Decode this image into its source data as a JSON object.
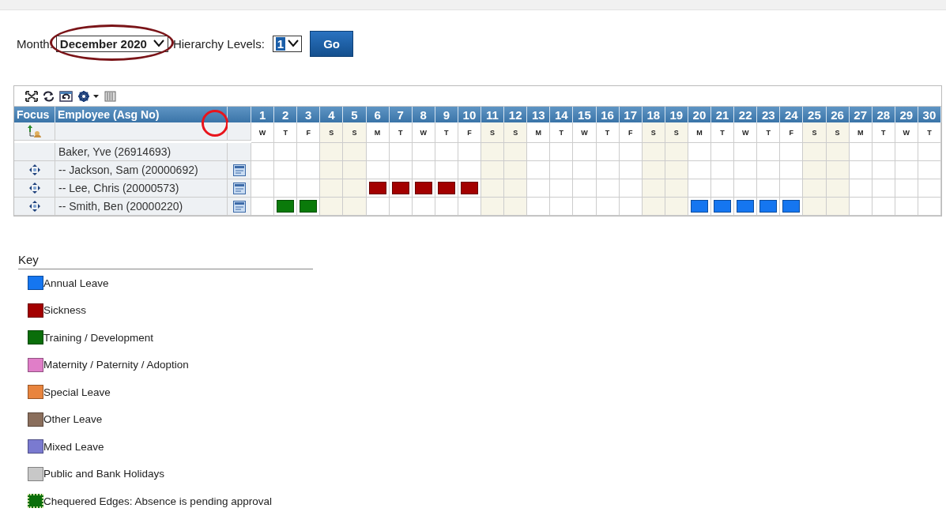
{
  "filters": {
    "month_label": "Month:",
    "month": "December 2020",
    "month_circled": true,
    "levels_label": "Hierarchy Levels:",
    "levels": "1",
    "go": "Go"
  },
  "table": {
    "columns": [
      "Focus",
      "Employee (Asg No)"
    ],
    "column_circled": true,
    "days": [
      {
        "day": "1",
        "weekday": "W",
        "weekend": false
      },
      {
        "day": "2",
        "weekday": "T",
        "weekend": false
      },
      {
        "day": "3",
        "weekday": "F",
        "weekend": false
      },
      {
        "day": "4",
        "weekday": "S",
        "weekend": true
      },
      {
        "day": "5",
        "weekday": "S",
        "weekend": true
      },
      {
        "day": "6",
        "weekday": "M",
        "weekend": false
      },
      {
        "day": "7",
        "weekday": "T",
        "weekend": false
      },
      {
        "day": "8",
        "weekday": "W",
        "weekend": false
      },
      {
        "day": "9",
        "weekday": "T",
        "weekend": false
      },
      {
        "day": "10",
        "weekday": "F",
        "weekend": false
      },
      {
        "day": "11",
        "weekday": "S",
        "weekend": true
      },
      {
        "day": "12",
        "weekday": "S",
        "weekend": true
      },
      {
        "day": "13",
        "weekday": "M",
        "weekend": false
      },
      {
        "day": "14",
        "weekday": "T",
        "weekend": false
      },
      {
        "day": "15",
        "weekday": "W",
        "weekend": false
      },
      {
        "day": "16",
        "weekday": "T",
        "weekend": false
      },
      {
        "day": "17",
        "weekday": "F",
        "weekend": false
      },
      {
        "day": "18",
        "weekday": "S",
        "weekend": true
      },
      {
        "day": "19",
        "weekday": "S",
        "weekend": true
      },
      {
        "day": "20",
        "weekday": "M",
        "weekend": false
      },
      {
        "day": "21",
        "weekday": "T",
        "weekend": false
      },
      {
        "day": "22",
        "weekday": "W",
        "weekend": false
      },
      {
        "day": "23",
        "weekday": "T",
        "weekend": false
      },
      {
        "day": "24",
        "weekday": "F",
        "weekend": false
      },
      {
        "day": "25",
        "weekday": "S",
        "weekend": true
      },
      {
        "day": "26",
        "weekday": "S",
        "weekend": true
      },
      {
        "day": "27",
        "weekday": "M",
        "weekend": false
      },
      {
        "day": "28",
        "weekday": "T",
        "weekend": false
      },
      {
        "day": "29",
        "weekday": "W",
        "weekend": false
      },
      {
        "day": "30",
        "weekday": "T",
        "weekend": false
      }
    ],
    "rows": [
      {
        "name": "Baker, Yve (26914693)",
        "focusable": false,
        "has_details": false,
        "cells": [
          {
            "absence": false
          },
          {
            "absence": false
          },
          {
            "absence": false
          },
          {
            "absence": false
          },
          {
            "absence": false
          },
          {
            "absence": false
          },
          {
            "absence": false
          },
          {
            "absence": false
          },
          {
            "absence": false
          },
          {
            "absence": false
          },
          {
            "absence": false
          },
          {
            "absence": false
          },
          {
            "absence": false
          },
          {
            "absence": false
          },
          {
            "absence": false
          },
          {
            "absence": false
          },
          {
            "absence": false
          },
          {
            "absence": false
          },
          {
            "absence": false
          },
          {
            "absence": false
          },
          {
            "absence": false
          },
          {
            "absence": false
          },
          {
            "absence": false
          },
          {
            "absence": false
          },
          {
            "absence": false
          },
          {
            "absence": false
          },
          {
            "absence": false
          },
          {
            "absence": false
          },
          {
            "absence": false
          },
          {
            "absence": false
          }
        ]
      },
      {
        "name": "-- Jackson, Sam (20000692)",
        "focusable": true,
        "has_details": true,
        "cells": [
          {
            "absence": false
          },
          {
            "absence": false
          },
          {
            "absence": false
          },
          {
            "absence": false
          },
          {
            "absence": false
          },
          {
            "absence": false
          },
          {
            "absence": false
          },
          {
            "absence": false
          },
          {
            "absence": false
          },
          {
            "absence": false
          },
          {
            "absence": false
          },
          {
            "absence": false
          },
          {
            "absence": false
          },
          {
            "absence": false
          },
          {
            "absence": false
          },
          {
            "absence": false
          },
          {
            "absence": false
          },
          {
            "absence": false
          },
          {
            "absence": false
          },
          {
            "absence": false
          },
          {
            "absence": false
          },
          {
            "absence": false
          },
          {
            "absence": false
          },
          {
            "absence": false
          },
          {
            "absence": false
          },
          {
            "absence": false
          },
          {
            "absence": false
          },
          {
            "absence": false
          },
          {
            "absence": false
          },
          {
            "absence": false
          }
        ]
      },
      {
        "name": "-- Lee, Chris (20000573)",
        "focusable": true,
        "has_details": true,
        "cells": [
          {
            "absence": false
          },
          {
            "absence": false
          },
          {
            "absence": false
          },
          {
            "absence": false
          },
          {
            "absence": false
          },
          {
            "absence": true,
            "color": "#a30000"
          },
          {
            "absence": true,
            "color": "#a30000"
          },
          {
            "absence": true,
            "color": "#a30000"
          },
          {
            "absence": true,
            "color": "#a30000"
          },
          {
            "absence": true,
            "color": "#a30000"
          },
          {
            "absence": false
          },
          {
            "absence": false
          },
          {
            "absence": false
          },
          {
            "absence": false
          },
          {
            "absence": false
          },
          {
            "absence": false
          },
          {
            "absence": false
          },
          {
            "absence": false
          },
          {
            "absence": false
          },
          {
            "absence": false
          },
          {
            "absence": false
          },
          {
            "absence": false
          },
          {
            "absence": false
          },
          {
            "absence": false
          },
          {
            "absence": false
          },
          {
            "absence": false
          },
          {
            "absence": false
          },
          {
            "absence": false
          },
          {
            "absence": false
          },
          {
            "absence": false
          }
        ]
      },
      {
        "name": "-- Smith, Ben (20000220)",
        "focusable": true,
        "has_details": true,
        "cells": [
          {
            "absence": false
          },
          {
            "absence": true,
            "color": "#0a7a0a"
          },
          {
            "absence": true,
            "color": "#0a7a0a"
          },
          {
            "absence": false
          },
          {
            "absence": false
          },
          {
            "absence": false
          },
          {
            "absence": false
          },
          {
            "absence": false
          },
          {
            "absence": false
          },
          {
            "absence": false
          },
          {
            "absence": false
          },
          {
            "absence": false
          },
          {
            "absence": false
          },
          {
            "absence": false
          },
          {
            "absence": false
          },
          {
            "absence": false
          },
          {
            "absence": false
          },
          {
            "absence": false
          },
          {
            "absence": false
          },
          {
            "absence": true,
            "color": "#1576f0"
          },
          {
            "absence": true,
            "color": "#1576f0"
          },
          {
            "absence": true,
            "color": "#1576f0"
          },
          {
            "absence": true,
            "color": "#1576f0"
          },
          {
            "absence": true,
            "color": "#1576f0"
          },
          {
            "absence": false
          },
          {
            "absence": false
          },
          {
            "absence": false
          },
          {
            "absence": false
          },
          {
            "absence": false
          },
          {
            "absence": false
          }
        ]
      }
    ]
  },
  "key": {
    "title": "Key",
    "items": [
      {
        "label": "Annual Leave",
        "color": "#1576f0",
        "kind": "solid"
      },
      {
        "label": "Sickness",
        "color": "#a30000",
        "kind": "solid"
      },
      {
        "label": "Training / Development",
        "color": "#0a6e0a",
        "kind": "solid"
      },
      {
        "label": "Maternity / Paternity / Adoption",
        "color": "#e07ec8",
        "kind": "solid"
      },
      {
        "label": "Special Leave",
        "color": "#e8843e",
        "kind": "solid"
      },
      {
        "label": "Other Leave",
        "color": "#8a6e5c",
        "kind": "solid"
      },
      {
        "label": "Mixed Leave",
        "color": "#7a7ad0",
        "kind": "solid"
      },
      {
        "label": "Public and Bank Holidays",
        "color": "#c8c8c8",
        "kind": "solid"
      },
      {
        "label": "Chequered Edges: Absence is pending approval",
        "color": "#0a6e0a",
        "kind": "chequered"
      }
    ]
  }
}
